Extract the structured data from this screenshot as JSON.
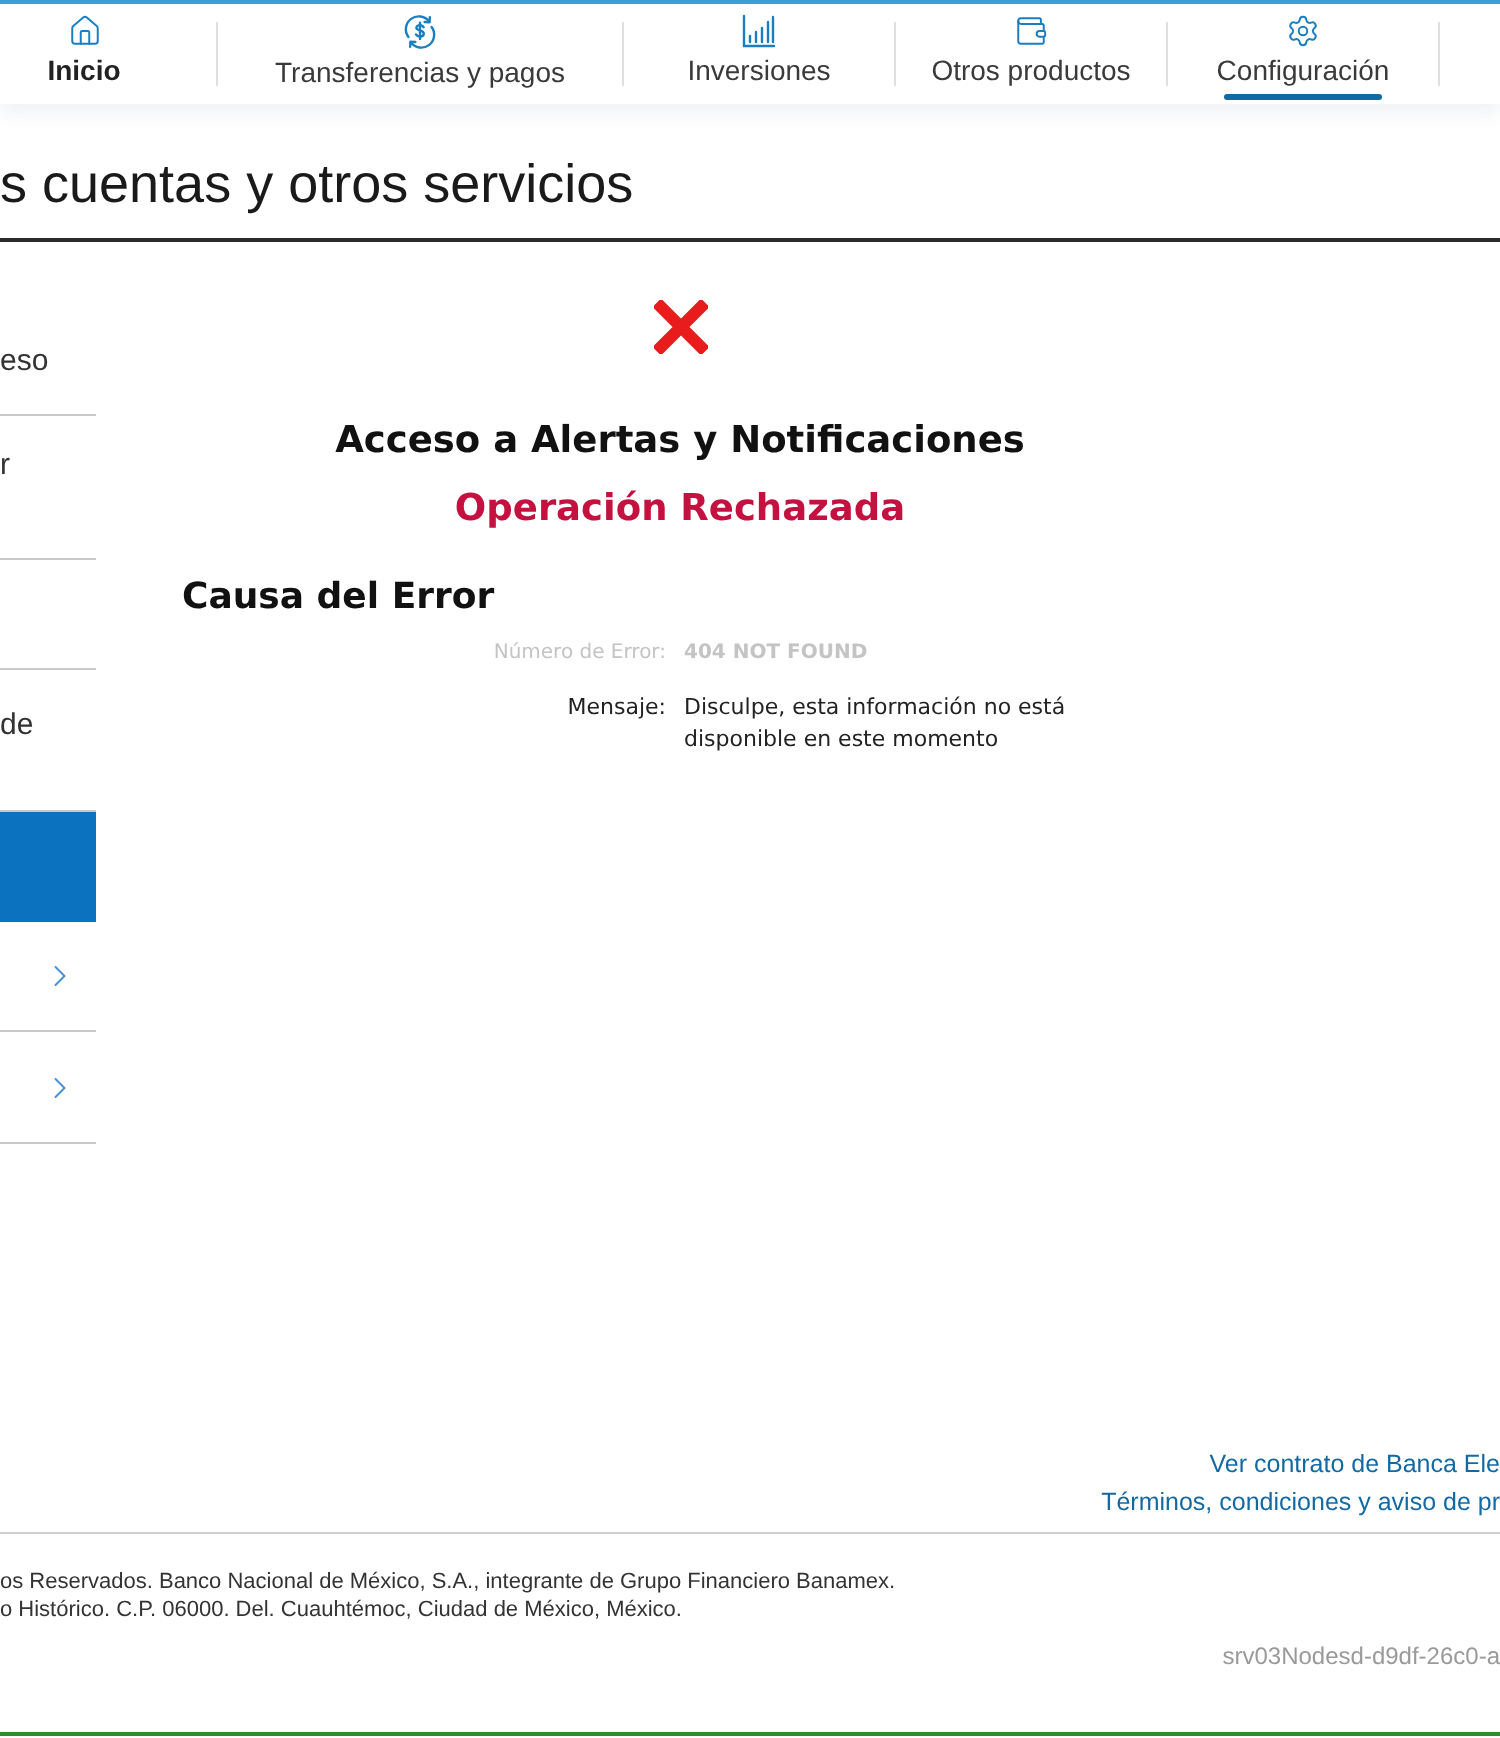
{
  "nav": {
    "tabs": [
      {
        "label": "Inicio",
        "selected": false,
        "emphasized": true
      },
      {
        "label": "Transferencias y pagos",
        "selected": false,
        "emphasized": false
      },
      {
        "label": "Inversiones",
        "selected": false,
        "emphasized": false
      },
      {
        "label": "Otros productos",
        "selected": false,
        "emphasized": false
      },
      {
        "label": "Configuración",
        "selected": true,
        "emphasized": false
      }
    ]
  },
  "page_title": "s cuentas y otros servicios",
  "sidebar": {
    "items": [
      {
        "label": "eso",
        "selected": false,
        "chevron": false
      },
      {
        "label": "r",
        "selected": false,
        "chevron": false
      },
      {
        "selected": false,
        "chevron": false
      },
      {
        "label": "de",
        "selected": false,
        "chevron": false
      },
      {
        "selected": true,
        "chevron": false
      },
      {
        "selected": false,
        "chevron": true
      },
      {
        "selected": false,
        "chevron": true
      }
    ]
  },
  "error": {
    "title": "Acceso a Alertas y Notificaciones",
    "status": "Operación Rechazada",
    "cause_heading": "Causa del Error",
    "details": [
      {
        "kind": "code",
        "label": "Número de Error:",
        "value": "404 NOT FOUND"
      },
      {
        "kind": "message",
        "label": "Mensaje:",
        "value": "Disculpe, esta información no está disponible en este momento"
      }
    ]
  },
  "footer": {
    "links": [
      "Ver contrato de Banca Ele",
      "Términos, condiciones y aviso de pr"
    ],
    "legal": [
      "os Reservados. Banco Nacional de México, S.A., integrante de Grupo Financiero Banamex.",
      "o Histórico. C.P. 06000. Del. Cuauhtémoc, Ciudad de México, México."
    ],
    "server": "srv03Nodesd-d9df-26c0-a"
  }
}
